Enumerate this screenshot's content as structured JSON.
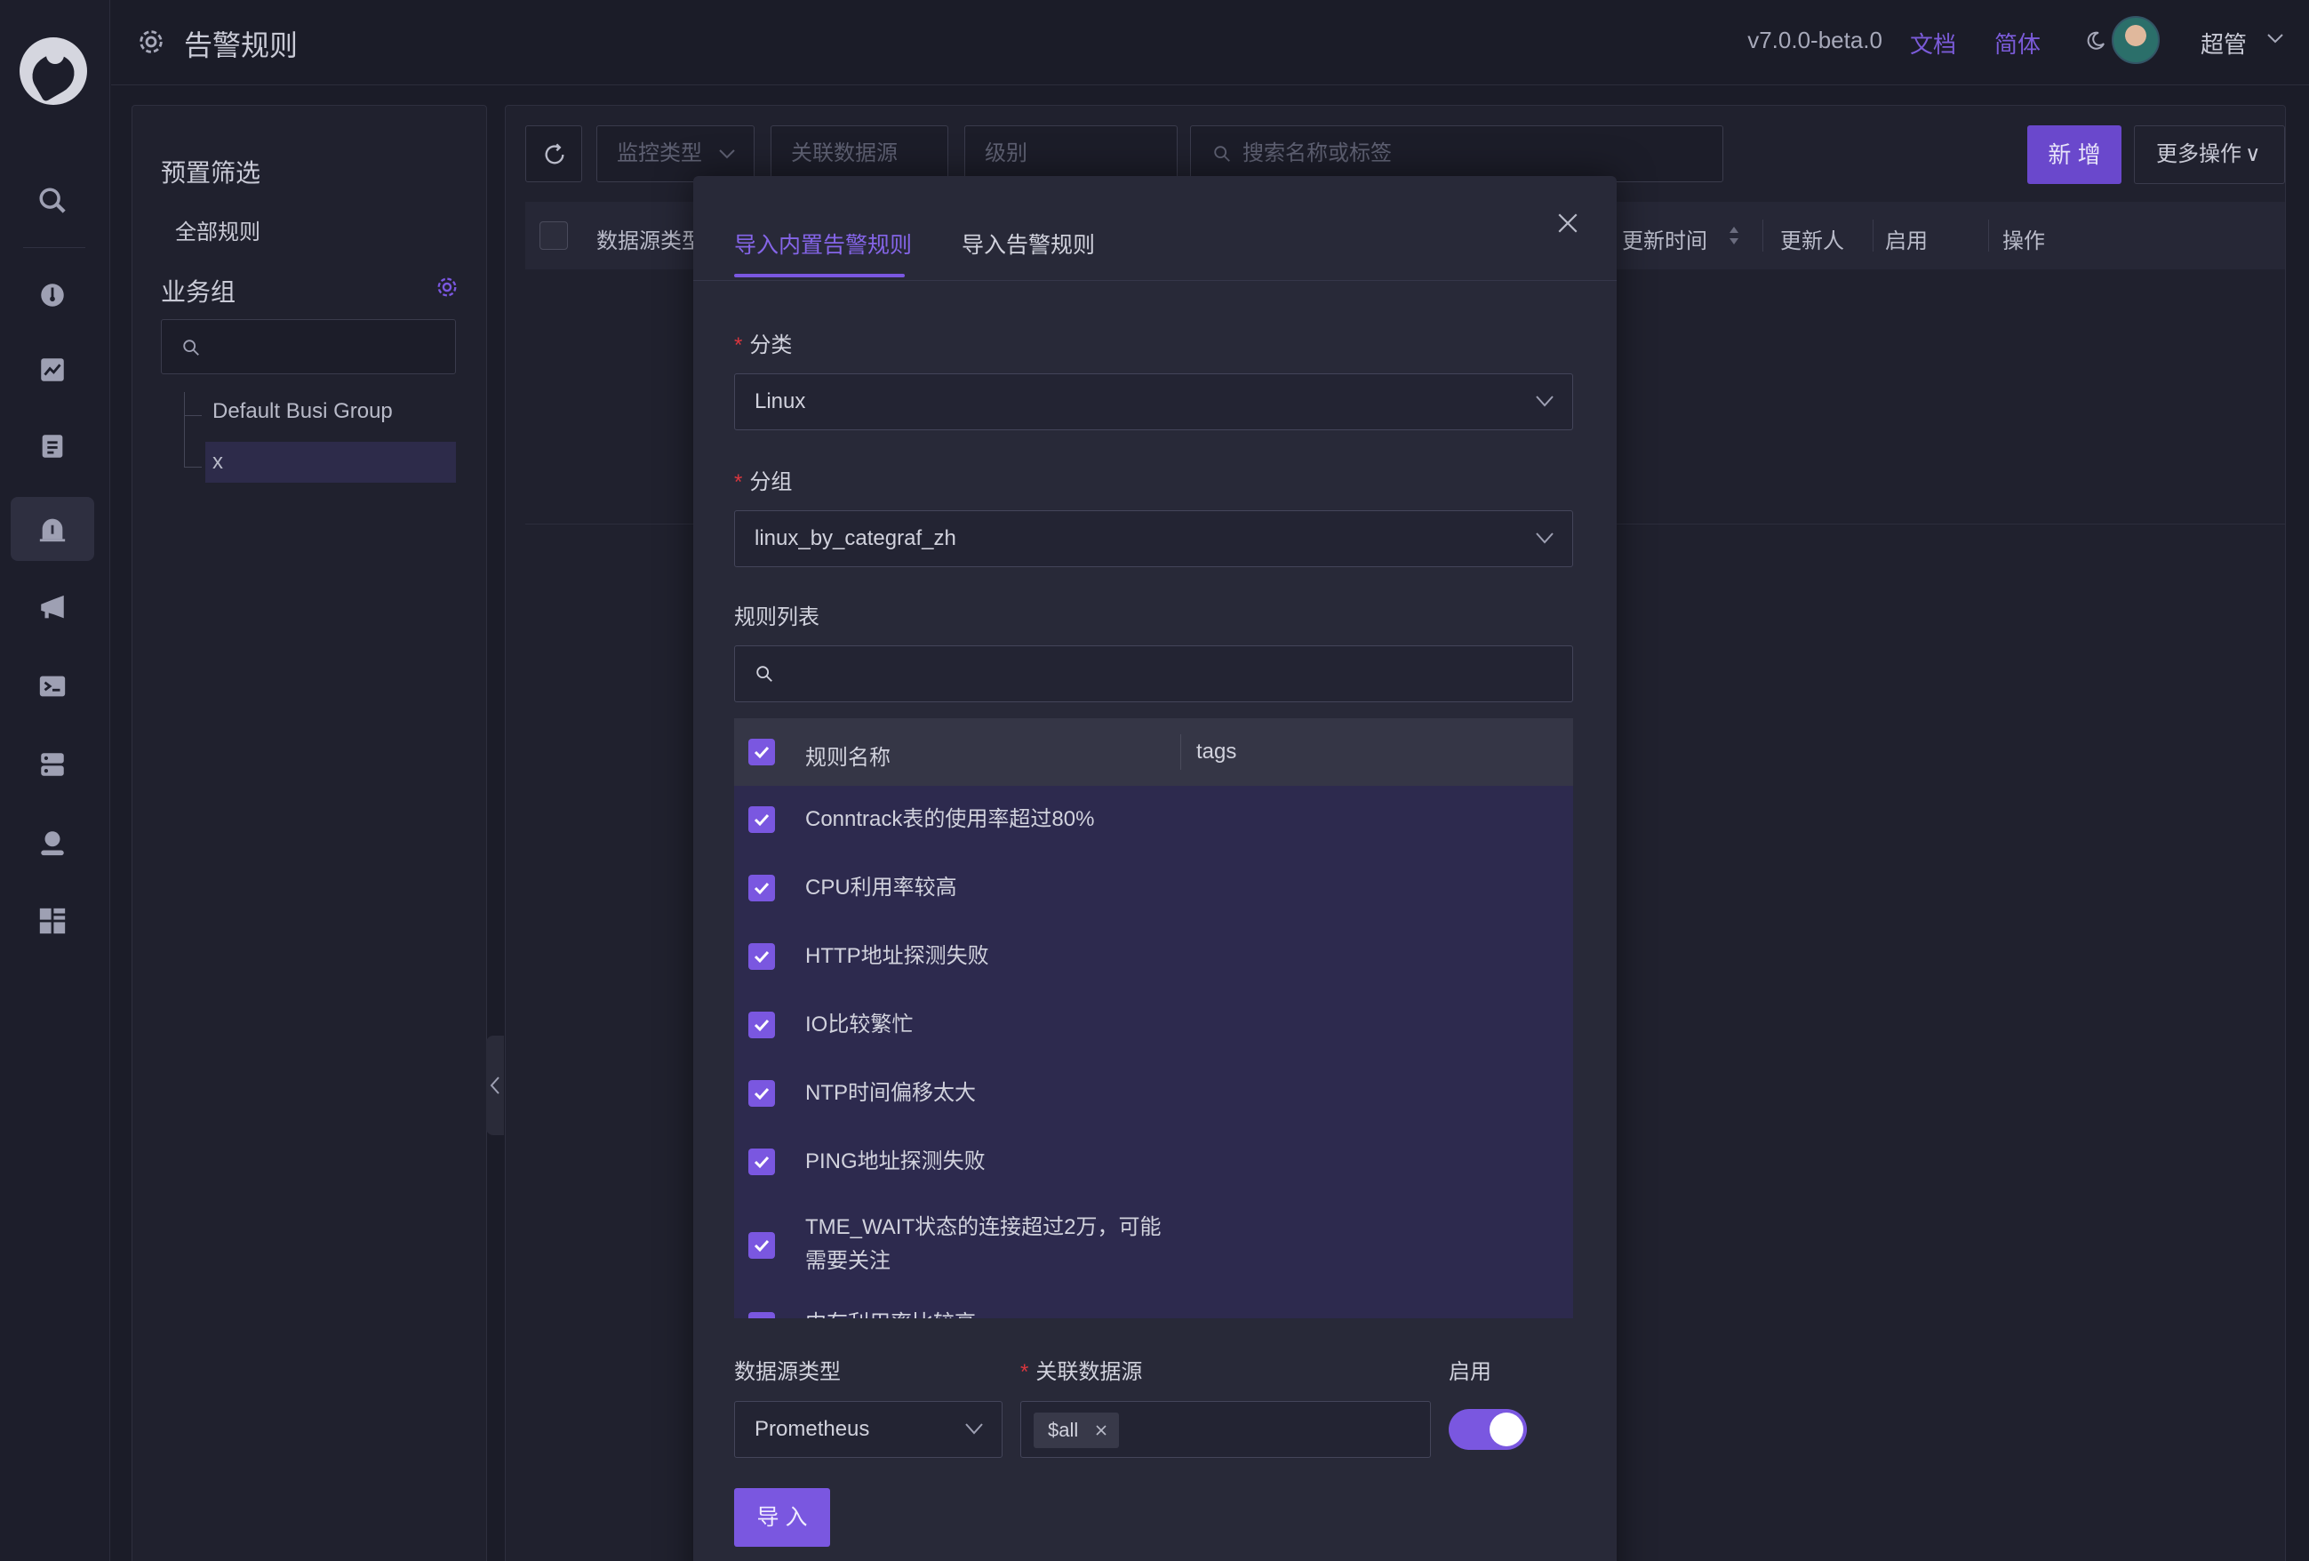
{
  "header": {
    "title": "告警规则",
    "version": "v7.0.0-beta.0",
    "docs_link": "文档",
    "lang_link": "简体",
    "user_name": "超管"
  },
  "sidebar_icons": [
    "search-icon",
    "dashboard-icon",
    "chart-icon",
    "log-icon",
    "alert-rule-icon",
    "notify-icon",
    "terminal-icon",
    "server-icon",
    "user-icon",
    "apps-icon"
  ],
  "filter_panel": {
    "preset_title": "预置筛选",
    "all_rules": "全部规则",
    "business_group_title": "业务组",
    "search_placeholder": "",
    "groups": [
      "Default Busi Group",
      "x"
    ]
  },
  "toolbar": {
    "monitor_type_placeholder": "监控类型",
    "datasource_placeholder": "关联数据源",
    "level_placeholder": "级别",
    "search_placeholder": "搜索名称或标签",
    "new_button": "新 增",
    "more_button": "更多操作"
  },
  "table_headers": [
    "数据源类型",
    "更新时间",
    "更新人",
    "启用",
    "操作"
  ],
  "modal": {
    "tabs": [
      "导入内置告警规则",
      "导入告警规则"
    ],
    "category_label": "分类",
    "category_value": "Linux",
    "group_label": "分组",
    "group_value": "linux_by_categraf_zh",
    "rule_list_label": "规则列表",
    "rule_table_headers": [
      "规则名称",
      "tags"
    ],
    "rules": [
      "Conntrack表的使用率超过80%",
      "CPU利用率较高",
      "HTTP地址探测失败",
      "IO比较繁忙",
      "NTP时间偏移太大",
      "PING地址探测失败",
      "TME_WAIT状态的连接超过2万，可能需要关注",
      "内存利用率比较高"
    ],
    "datasource_type_label": "数据源类型",
    "datasource_type_value": "Prometheus",
    "linked_datasource_label": "关联数据源",
    "linked_datasource_tag": "$all",
    "enable_label": "启用",
    "enable_on": true,
    "import_button": "导 入"
  },
  "colors": {
    "accent": "#7a57e0",
    "background": "#1b1c28",
    "modal_bg": "#282938",
    "required": "#d9363e"
  }
}
